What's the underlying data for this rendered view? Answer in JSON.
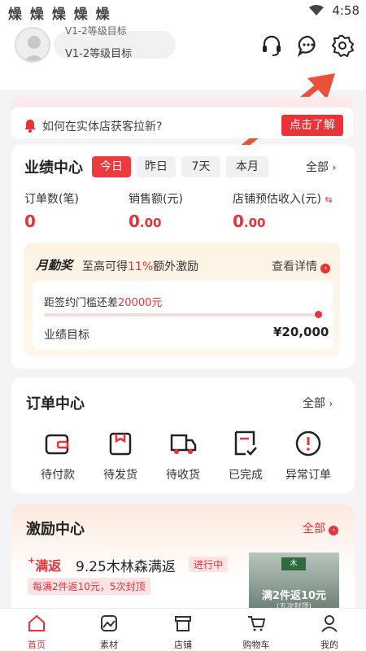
{
  "status": {
    "left_icons": "燥 燥 燥 燥 燥",
    "time": "4:58"
  },
  "header": {
    "user_line1": "V1-2等级目标",
    "user_line2": "V1-2等级目标"
  },
  "notice": {
    "text": "如何在实体店获客拉新?",
    "button": "点击了解"
  },
  "performance": {
    "title": "业绩中心",
    "tabs": [
      "今日",
      "昨日",
      "7天",
      "本月"
    ],
    "all": "全部",
    "metrics": [
      {
        "label": "订单数(笔)",
        "value": "0",
        "decimal": ""
      },
      {
        "label": "销售额(元)",
        "value": "0",
        "decimal": ".00"
      },
      {
        "label": "店铺预估收入(元)",
        "value": "0",
        "decimal": ".00"
      }
    ],
    "bonus": {
      "title": "月勤奖",
      "desc_prefix": "至高可得",
      "desc_pct": "11%",
      "desc_suffix": "额外激励",
      "detail": "查看详情",
      "gap_prefix": "距签约门槛还差",
      "gap_value": "20000元",
      "target_label": "业绩目标",
      "target_value": "¥20,000",
      "progress": 1.0
    }
  },
  "orders": {
    "title": "订单中心",
    "all": "全部",
    "items": [
      "待付款",
      "待发货",
      "待收货",
      "已完成",
      "异常订单"
    ]
  },
  "incentive": {
    "title": "激励中心",
    "all": "全部",
    "promo_badge": "满返",
    "promo_title": "9.25木林森满返",
    "promo_status": "进行中",
    "promo_sub": "每满2件返10元，5次封顶",
    "promo_img_text": "满2件返10元",
    "promo_img_sub": "(五次封顶)"
  },
  "tabbar": [
    "首页",
    "素材",
    "店铺",
    "购物车",
    "我的"
  ],
  "colors": {
    "accent": "#e8333b"
  }
}
